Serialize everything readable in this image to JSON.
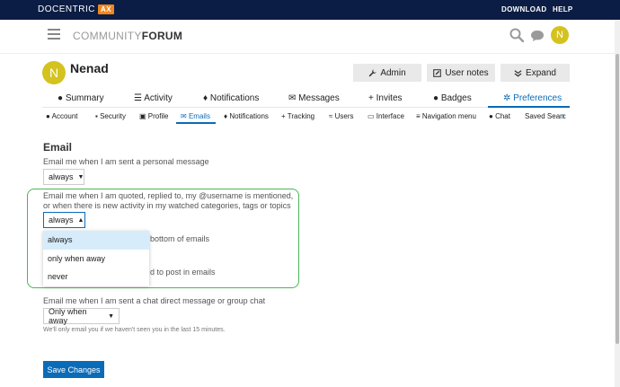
{
  "topbar": {
    "brand": "DOCENTRIC",
    "brand_badge": "AX",
    "links": [
      "DOWNLOAD",
      "HELP"
    ]
  },
  "header": {
    "logo_light": "COMMUNITY",
    "logo_bold": "FORUM",
    "avatar_letter": "N"
  },
  "profile": {
    "avatar_letter": "N",
    "username": "Nenad",
    "buttons": [
      {
        "label": "Admin",
        "icon": "wrench-icon"
      },
      {
        "label": "User notes",
        "icon": "pencil-icon"
      },
      {
        "label": "Expand",
        "icon": "expand-icon"
      }
    ]
  },
  "nav_primary": [
    {
      "label": "Summary",
      "icon": "user-icon"
    },
    {
      "label": "Activity",
      "icon": "list-icon"
    },
    {
      "label": "Notifications",
      "icon": "bell-icon"
    },
    {
      "label": "Messages",
      "icon": "envelope-icon"
    },
    {
      "label": "Invites",
      "icon": "user-plus-icon"
    },
    {
      "label": "Badges",
      "icon": "badge-icon"
    },
    {
      "label": "Preferences",
      "icon": "gear-icon",
      "active": true
    }
  ],
  "nav_secondary": [
    {
      "label": "Account"
    },
    {
      "label": "Security"
    },
    {
      "label": "Profile"
    },
    {
      "label": "Emails",
      "active": true
    },
    {
      "label": "Notifications"
    },
    {
      "label": "Tracking"
    },
    {
      "label": "Users"
    },
    {
      "label": "Interface"
    },
    {
      "label": "Navigation menu"
    },
    {
      "label": "Chat"
    },
    {
      "label": "Saved Searc"
    }
  ],
  "email": {
    "title": "Email",
    "personal_label": "Email me when I am sent a personal message",
    "personal_value": "always",
    "quoted_label_1": "Email me when I am quoted, replied to, my @username is mentioned,",
    "quoted_label_2": "or when there is new activity in my watched categories, tags or topics",
    "quoted_value": "always",
    "dropdown_options": [
      "always",
      "only when away",
      "never"
    ],
    "partial_1": "bottom of emails",
    "partial_2": "d to post in emails",
    "chat_label": "Email me when I am sent a chat direct message or group chat",
    "chat_value": "Only when away",
    "chat_hint": "We'll only email you if we haven't seen you in the last 15 minutes.",
    "save_label": "Save Changes"
  },
  "colors": {
    "topbar": "#0b1d44",
    "accent": "#0a6bb8",
    "avatar": "#d4c21e",
    "highlight": "#4bb557",
    "brand_badge": "#f0861f"
  }
}
